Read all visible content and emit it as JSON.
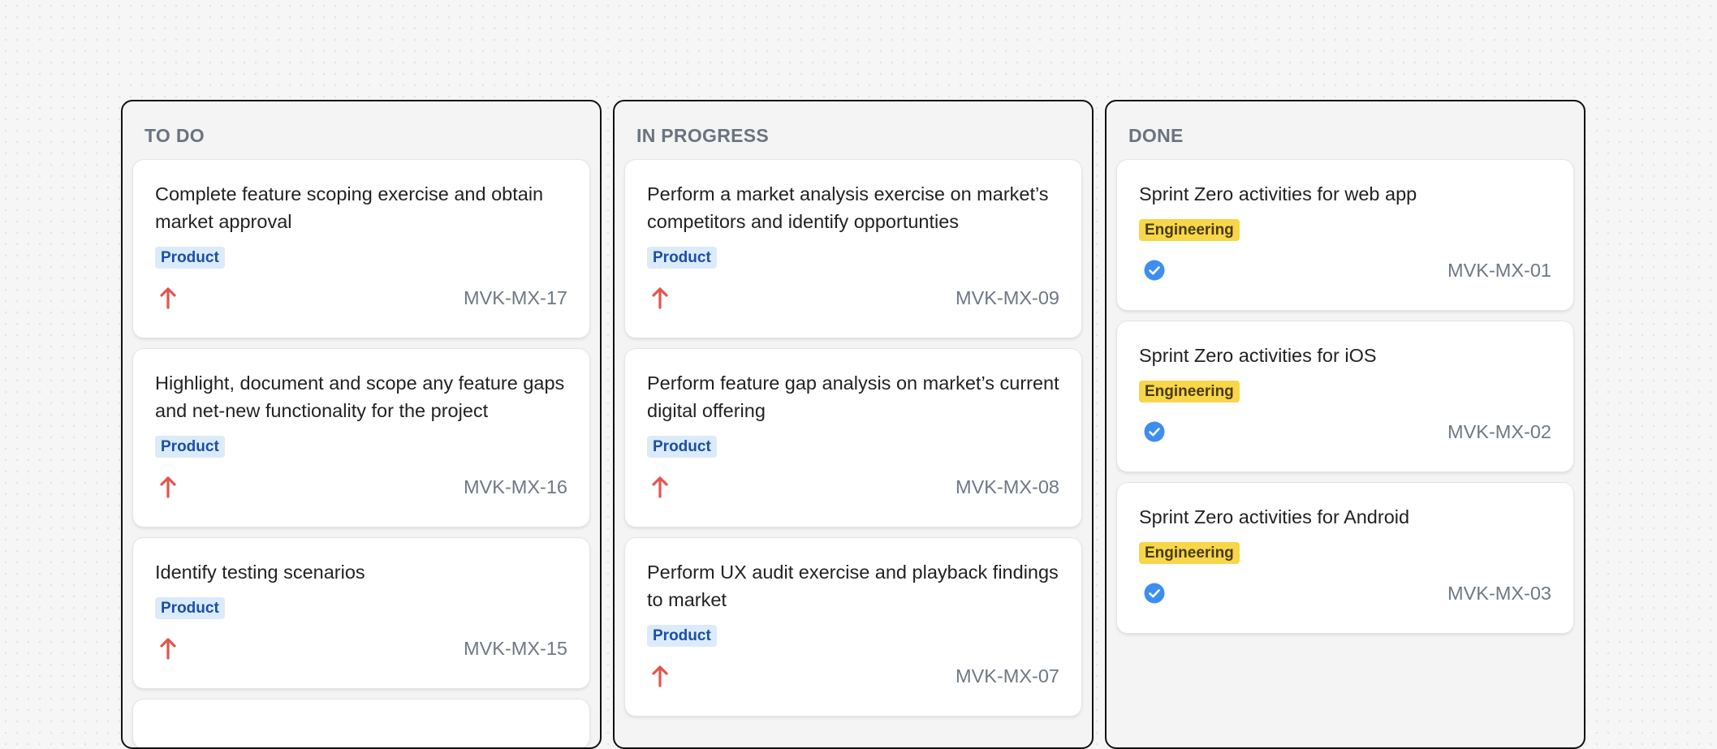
{
  "colors": {
    "product_tag_bg": "#dcebfb",
    "product_tag_text": "#1a4fa6",
    "engineering_tag_bg": "#f7d64a",
    "engineering_tag_text": "#4a3c12",
    "priority_arrow": "#e5534b",
    "done_check": "#3d8ef0"
  },
  "columns": [
    {
      "title": "TO DO",
      "cards": [
        {
          "title": "Complete feature scoping exercise and obtain market approval",
          "tag": "Product",
          "icon": "arrow-up-icon",
          "id": "MVK-MX-17"
        },
        {
          "title": "Highlight, document and scope any feature gaps and net-new functionality for the project",
          "tag": "Product",
          "icon": "arrow-up-icon",
          "id": "MVK-MX-16"
        },
        {
          "title": "Identify testing scenarios",
          "tag": "Product",
          "icon": "arrow-up-icon",
          "id": "MVK-MX-15"
        }
      ]
    },
    {
      "title": "IN PROGRESS",
      "cards": [
        {
          "title": "Perform a market analysis exercise on market’s competitors and identify opportunties",
          "tag": "Product",
          "icon": "arrow-up-icon",
          "id": "MVK-MX-09"
        },
        {
          "title": "Perform feature gap analysis on market’s current digital offering",
          "tag": "Product",
          "icon": "arrow-up-icon",
          "id": "MVK-MX-08"
        },
        {
          "title": "Perform UX audit exercise and playback findings to market",
          "tag": "Product",
          "icon": "arrow-up-icon",
          "id": "MVK-MX-07"
        }
      ]
    },
    {
      "title": "DONE",
      "cards": [
        {
          "title": "Sprint Zero activities for web app",
          "tag": "Engineering",
          "icon": "check-circle-icon",
          "id": "MVK-MX-01"
        },
        {
          "title": "Sprint Zero activities for iOS",
          "tag": "Engineering",
          "icon": "check-circle-icon",
          "id": "MVK-MX-02"
        },
        {
          "title": "Sprint Zero activities for Android",
          "tag": "Engineering",
          "icon": "check-circle-icon",
          "id": "MVK-MX-03"
        }
      ]
    }
  ]
}
